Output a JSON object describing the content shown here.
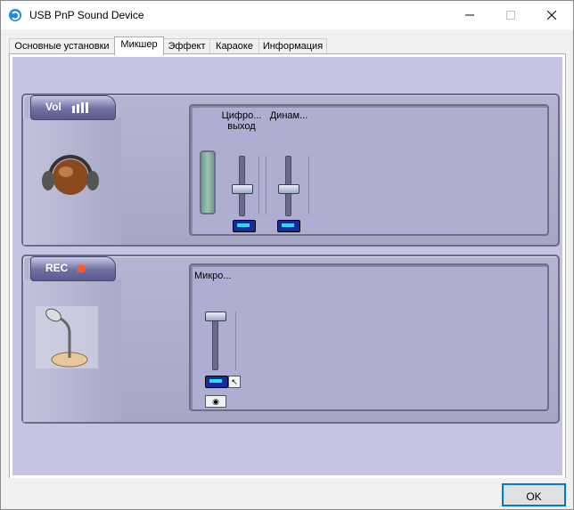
{
  "window": {
    "title": "USB PnP Sound Device"
  },
  "tabs": [
    {
      "label": "Основные установки"
    },
    {
      "label": "Микшер"
    },
    {
      "label": "Эффект"
    },
    {
      "label": "Караоке"
    },
    {
      "label": "Информация"
    }
  ],
  "active_tab": "Микшер",
  "playback": {
    "badge": "Vol",
    "channels": [
      {
        "label": "Цифро... выход",
        "level": 0.45
      },
      {
        "label": "Динам...",
        "level": 0.45
      }
    ]
  },
  "record": {
    "badge": "REC",
    "channels": [
      {
        "label": "Микро...",
        "level": 1.0
      }
    ]
  },
  "ok_label": "OK",
  "colors": {
    "mixer_bg": "#c5c5e3",
    "panel": "#aeaed2",
    "accent": "#0078d7"
  },
  "icons": [
    "sound-app-icon",
    "minimize-icon",
    "maximize-icon",
    "close-icon",
    "headphones-icon",
    "microphone-icon",
    "mute-toggle-icon",
    "link-icon",
    "record-indicator-icon"
  ]
}
